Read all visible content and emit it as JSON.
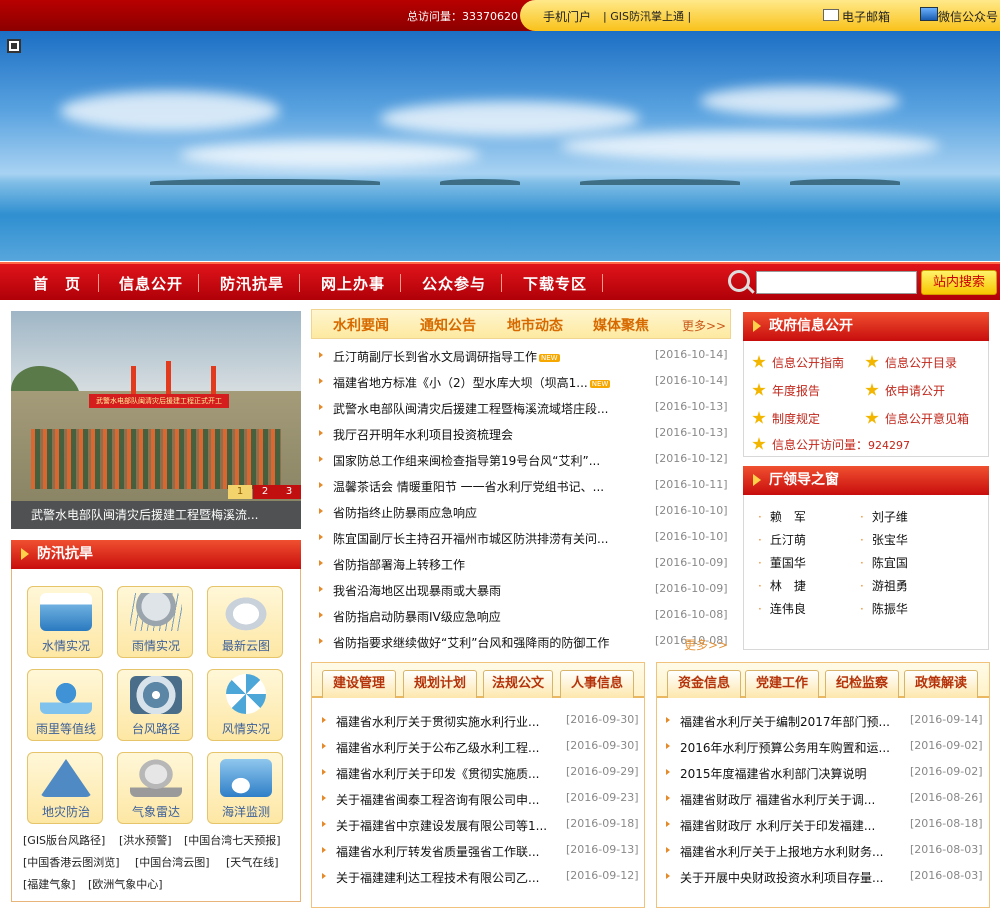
{
  "topbar": {
    "visit_label": "总访问量：",
    "visit_count": "33370620",
    "mobile_portal": "手机门户",
    "gis": "| GIS防汛掌上通 |",
    "email": "电子邮箱",
    "wechat": "微信公众号"
  },
  "nav": {
    "items": [
      "首　页",
      "信息公开",
      "防汛抗旱",
      "网上办事",
      "公众参与",
      "下载专区"
    ],
    "search_button": "站内搜索"
  },
  "slideshow": {
    "banner_text": "武警水电部队闽清灾后援建工程正式开工",
    "caption": "武警水电部队闽清灾后援建工程暨梅溪流...",
    "pages": [
      "1",
      "2",
      "3"
    ]
  },
  "flood": {
    "title": "防汛抗旱",
    "icons": [
      {
        "label": "水情实况",
        "icon": "water-gauge-icon",
        "color": "#6fb0e0"
      },
      {
        "label": "雨情实况",
        "icon": "rain-cloud-icon",
        "color": "#9aa4ac"
      },
      {
        "label": "最新云图",
        "icon": "cloud-icon",
        "color": "#c9d2da"
      },
      {
        "label": "雨里等值线",
        "icon": "rain-drop-icon",
        "color": "#3f92d6"
      },
      {
        "label": "台风路径",
        "icon": "typhoon-icon",
        "color": "#5b86a6"
      },
      {
        "label": "风情实况",
        "icon": "windmill-icon",
        "color": "#4da6d8"
      },
      {
        "label": "地灾防治",
        "icon": "warning-sign-icon",
        "color": "#4f8ac4"
      },
      {
        "label": "气象雷达",
        "icon": "radar-dish-icon",
        "color": "#b7b7b7"
      },
      {
        "label": "海洋监测",
        "icon": "ocean-wave-icon",
        "color": "#2f7fc8"
      }
    ],
    "links": [
      "[GIS版台风路径]",
      "[洪水预警]",
      "[中国台湾七天预报]",
      "[中国香港云图浏览]",
      "[中国台湾云图]",
      "[天气在线]",
      "[福建气象]",
      "[欧洲气象中心]"
    ]
  },
  "news": {
    "tabs": [
      "水利要闻",
      "通知公告",
      "地市动态",
      "媒体聚焦"
    ],
    "more": "更多>>",
    "rows": [
      {
        "title": "丘汀萌副厅长到省水文局调研指导工作",
        "date": "[2016-10-14]",
        "new": "NEW"
      },
      {
        "title": "福建省地方标准《小（2）型水库大坝（坝高1...",
        "date": "[2016-10-14]",
        "new": "NEW"
      },
      {
        "title": "武警水电部队闽清灾后援建工程暨梅溪流域塔庄段...",
        "date": "[2016-10-13]",
        "new": ""
      },
      {
        "title": "我厅召开明年水利项目投资梳理会",
        "date": "[2016-10-13]",
        "new": ""
      },
      {
        "title": "国家防总工作组来闽检查指导第19号台风“艾利”...",
        "date": "[2016-10-12]",
        "new": ""
      },
      {
        "title": "温馨茶话会 情暖重阳节 一一省水利厅党组书记、...",
        "date": "[2016-10-11]",
        "new": ""
      },
      {
        "title": "省防指终止防暴雨应急响应",
        "date": "[2016-10-10]",
        "new": ""
      },
      {
        "title": "陈宜国副厅长主持召开福州市城区防洪排涝有关问...",
        "date": "[2016-10-10]",
        "new": ""
      },
      {
        "title": "省防指部署海上转移工作",
        "date": "[2016-10-09]",
        "new": ""
      },
      {
        "title": "我省沿海地区出现暴雨或大暴雨",
        "date": "[2016-10-09]",
        "new": ""
      },
      {
        "title": "省防指启动防暴雨IV级应急响应",
        "date": "[2016-10-08]",
        "new": ""
      },
      {
        "title": "省防指要求继续做好“艾利”台风和强降雨的防御工作",
        "date": "[2016-10-08]",
        "new": ""
      }
    ],
    "more2": "更多>>"
  },
  "construction": {
    "tabs": [
      "建设管理",
      "规划计划",
      "法规公文",
      "人事信息"
    ],
    "rows": [
      {
        "title": "福建省水利厅关于贯彻实施水利行业...",
        "date": "[2016-09-30]"
      },
      {
        "title": "福建省水利厅关于公布乙级水利工程...",
        "date": "[2016-09-30]"
      },
      {
        "title": "福建省水利厅关于印发《贯彻实施质...",
        "date": "[2016-09-29]"
      },
      {
        "title": "关于福建省闽泰工程咨询有限公司申...",
        "date": "[2016-09-23]"
      },
      {
        "title": "关于福建省中京建设发展有限公司等1...",
        "date": "[2016-09-18]"
      },
      {
        "title": "福建省水利厅转发省质量强省工作联...",
        "date": "[2016-09-13]"
      },
      {
        "title": "关于福建建利达工程技术有限公司乙...",
        "date": "[2016-09-12]"
      }
    ]
  },
  "funds": {
    "tabs": [
      "资金信息",
      "党建工作",
      "纪检监察",
      "政策解读"
    ],
    "rows": [
      {
        "title": "福建省水利厅关于编制2017年部门预...",
        "date": "[2016-09-14]"
      },
      {
        "title": "2016年水利厅预算公务用车购置和运...",
        "date": "[2016-09-02]"
      },
      {
        "title": "2015年度福建省水利部门决算说明",
        "date": "[2016-09-02]"
      },
      {
        "title": "福建省财政厅 福建省水利厅关于调...",
        "date": "[2016-08-26]"
      },
      {
        "title": "福建省财政厅 水利厅关于印发福建...",
        "date": "[2016-08-18]"
      },
      {
        "title": "福建省水利厅关于上报地方水利财务...",
        "date": "[2016-08-03]"
      },
      {
        "title": "关于开展中央财政投资水利项目存量...",
        "date": "[2016-08-03]"
      }
    ]
  },
  "gov_info": {
    "title": "政府信息公开",
    "items": [
      "信息公开指南",
      "信息公开目录",
      "年度报告",
      "依申请公开",
      "制度规定",
      "信息公开意见箱"
    ],
    "visit_label": "信息公开访问量：",
    "visit_count": "924297"
  },
  "leaders": {
    "title": "厅领导之窗",
    "names": [
      "赖　军",
      "刘子维",
      "丘汀萌",
      "张宝华",
      "董国华",
      "陈宜国",
      "林　捷",
      "游祖勇",
      "连伟良",
      "陈振华"
    ]
  }
}
